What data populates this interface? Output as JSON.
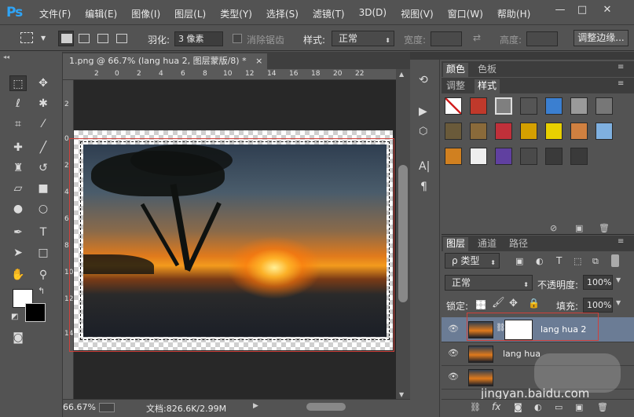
{
  "app": {
    "logo": "Ps"
  },
  "menu": [
    "文件(F)",
    "编辑(E)",
    "图像(I)",
    "图层(L)",
    "类型(Y)",
    "选择(S)",
    "滤镜(T)",
    "3D(D)",
    "视图(V)",
    "窗口(W)",
    "帮助(H)"
  ],
  "window_controls": {
    "minimize": "—",
    "maximize": "□",
    "close": "✕"
  },
  "options": {
    "feather_label": "羽化:",
    "feather_value": "3 像素",
    "antialias_label": "消除锯齿",
    "style_label": "样式:",
    "style_value": "正常",
    "width_label": "宽度:",
    "height_label": "高度:",
    "refine_edge": "调整边缘..."
  },
  "document": {
    "tab_title": "1.png @ 66.7% (lang hua 2, 图层蒙版/8) *",
    "tab_close": "×",
    "ruler_top": [
      "2",
      "0",
      "2",
      "4",
      "6",
      "8",
      "10",
      "12",
      "14",
      "16",
      "18",
      "20",
      "22"
    ],
    "ruler_left": [
      "2",
      "0",
      "2",
      "4",
      "6",
      "8",
      "10",
      "12",
      "14"
    ]
  },
  "status": {
    "zoom": "66.67%",
    "doc_info": "文档:826.6K/2.99M"
  },
  "color_panel": {
    "tabs": [
      "颜色",
      "色板"
    ],
    "tabs2": [
      "调整",
      "样式"
    ]
  },
  "styles_swatches": [
    "#ffffff",
    "#c0392b",
    "#7f7f7f",
    "#555555",
    "#3b7fd0",
    "#9a9a9a",
    "#777777",
    "#6a5a3a",
    "#8a6a3a",
    "#c0303a",
    "#d4a000",
    "#e8d000",
    "#d08040",
    "#7fb0e0",
    "#d08020",
    "#eeeeee",
    "#6040a0",
    "#4a4a4a",
    "#3a3a3a",
    "#3a3a3a"
  ],
  "layers_panel": {
    "tabs": [
      "图层",
      "通道",
      "路径"
    ],
    "filter_label": "ρ 类型",
    "blend_mode": "正常",
    "opacity_label": "不透明度:",
    "opacity_value": "100%",
    "lock_label": "锁定:",
    "fill_label": "填充:",
    "fill_value": "100%",
    "layers": [
      {
        "name": "lang hua 2",
        "selected": true,
        "has_mask": true
      },
      {
        "name": "lang hua",
        "selected": false,
        "has_mask": false
      },
      {
        "name": "",
        "selected": false,
        "has_mask": false
      }
    ],
    "footer_icons": [
      "link-icon",
      "fx-icon",
      "mask-icon",
      "adjustment-icon",
      "folder-icon",
      "new-layer-icon",
      "trash-icon"
    ],
    "fx_label": "fx"
  },
  "watermark": "jingyan.baidu.com",
  "colors": {
    "accent": "#2fa4f6",
    "selection_frame": "#d0403a",
    "selected_layer": "#6b7c95"
  }
}
